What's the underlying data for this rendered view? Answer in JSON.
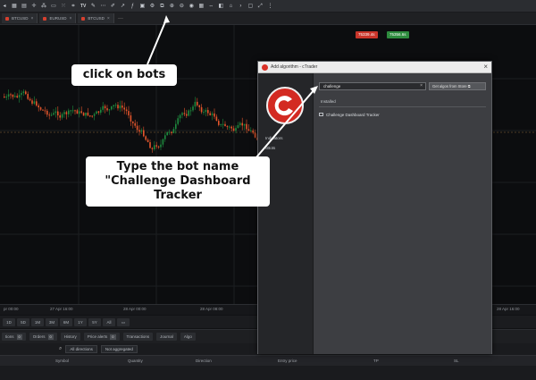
{
  "tabs": [
    {
      "label": "BTCUSD"
    },
    {
      "label": "EURUSD"
    },
    {
      "label": "BTCUSD"
    }
  ],
  "price_badges": {
    "sell": "75339.4s",
    "buy": "75356.6s"
  },
  "date_axis": [
    "pr 00:00",
    "27 Apr 16:00",
    "28 Apr 00:00",
    "28 Apr 08:00",
    "28 Apr 16:00"
  ],
  "timeframes": [
    "1D",
    "5D",
    "1M",
    "3M",
    "6M",
    "1Y",
    "5Y",
    "All"
  ],
  "bottom_tabs": [
    {
      "label": "tions",
      "count": "0"
    },
    {
      "label": "Orders",
      "count": "0"
    },
    {
      "label": "History"
    },
    {
      "label": "Price alerts",
      "count": "0"
    },
    {
      "label": "Transactions"
    },
    {
      "label": "Journal"
    },
    {
      "label": "Algo"
    }
  ],
  "filters": {
    "direction": "All directions",
    "aggregation": "Not aggregated"
  },
  "columns": [
    "Symbol",
    "Quantity",
    "Direction",
    "Entry price",
    "TP",
    "SL"
  ],
  "dialog": {
    "title": "Add algorithm - cTrader",
    "side_items": [
      "Indicators",
      "cBots"
    ],
    "search_value": "challenge",
    "store_button": "Get algos from Store",
    "section": "Installed",
    "result": "Challenge Dashboard Tracker"
  },
  "annotations": {
    "bots": "click on bots",
    "type_line1": "Type the bot name",
    "type_line2": "\"Challenge Dashboard",
    "type_line3": "Tracker"
  },
  "colors": {
    "bull": "#1e8a3e",
    "bear": "#e3552b",
    "accent": "#d32a22"
  }
}
